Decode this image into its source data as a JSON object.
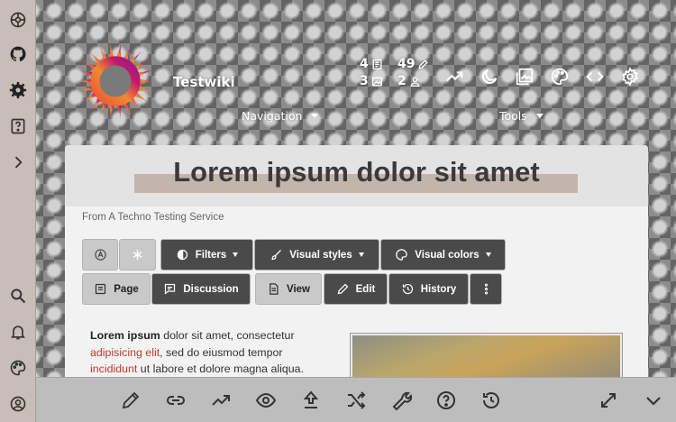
{
  "site": {
    "name": "Testwiki"
  },
  "stats": {
    "pages": "4",
    "edits": "49",
    "files": "3",
    "users": "2"
  },
  "menus": {
    "navigation": "Navigation",
    "tools": "Tools"
  },
  "page": {
    "title": "Lorem ipsum dolor sit amet",
    "tagline": "From A Techno Testing Service"
  },
  "actions": {
    "filters": "Filters",
    "visual_styles": "Visual styles",
    "visual_colors": "Visual colors",
    "page": "Page",
    "discussion": "Discussion",
    "view": "View",
    "edit": "Edit",
    "history": "History"
  },
  "body": {
    "lead_bold": "Lorem ipsum",
    "text1": " dolor sit amet, consectetur",
    "link1": "adipisicing elit",
    "text2": ", sed do eiusmod tempor",
    "link2": "incididunt",
    "text3": " ut labore et dolore magna aliqua."
  },
  "icons": {
    "rail_top": [
      "globe-icon",
      "github-icon",
      "gear-logo-icon",
      "help-icon",
      "expand-icon"
    ],
    "rail_bottom": [
      "search-icon",
      "bell-icon",
      "palette-icon",
      "user-icon"
    ],
    "header": [
      "trending-icon",
      "moon-icon",
      "image-icon",
      "palette-icon",
      "code-icon",
      "settings-icon"
    ],
    "bottom": [
      "edit-icon",
      "link-icon",
      "trending-icon",
      "eye-icon",
      "upload-icon",
      "shuffle-icon",
      "wrench-icon",
      "help-icon",
      "history-icon",
      "resize-icon",
      "chevron-down-icon"
    ]
  },
  "colors": {
    "rail": "#c9bdb7",
    "title_highlight": "#c2b5ab",
    "link": "#c0392b",
    "dark_button": "#4a4a4a"
  }
}
